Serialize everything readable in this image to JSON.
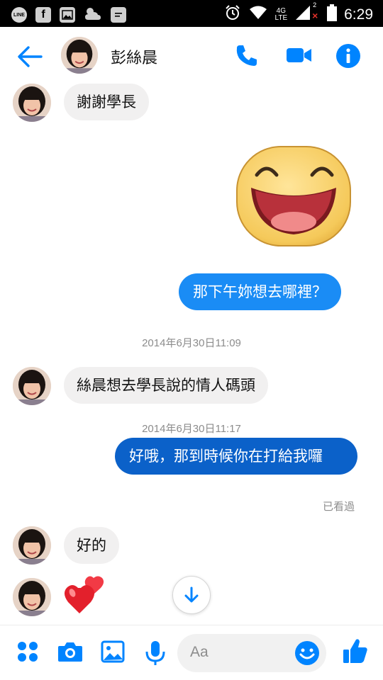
{
  "status_bar": {
    "time": "6:29",
    "network_top": "4G",
    "network_bottom": "LTE",
    "sim_slot": "2",
    "line_icon_text": "LINE",
    "icons": [
      "line-icon",
      "facebook-icon",
      "image-icon",
      "weather-icon",
      "chat-icon",
      "alarm-icon",
      "wifi-icon",
      "signal-icon",
      "battery-icon"
    ]
  },
  "header": {
    "contact_name": "彭絲晨",
    "icons": [
      "back-arrow-icon",
      "phone-icon",
      "video-icon",
      "info-icon"
    ]
  },
  "messages": {
    "m1": "謝謝學長",
    "m2": "那下午妳想去哪裡？",
    "ts1": "2014年6月30日11:09",
    "m3": "絲晨想去學長說的情人碼頭",
    "ts2": "2014年6月30日11:17",
    "m4": "好哦，那到時候你在打給我囉",
    "seen": "已看過",
    "m5": "好的",
    "stickers": [
      "laughing-face-sticker",
      "hearts-sticker"
    ]
  },
  "composer": {
    "placeholder": "Aa",
    "icons": [
      "apps-icon",
      "camera-icon",
      "gallery-icon",
      "microphone-icon",
      "emoji-icon",
      "thumbs-up-icon"
    ]
  },
  "colors": {
    "accent": "#0084ff",
    "bubble_outgoing": "#1a8cf5",
    "bubble_outgoing_selected": "#0b61c9",
    "bubble_incoming": "#f1f0f0"
  }
}
